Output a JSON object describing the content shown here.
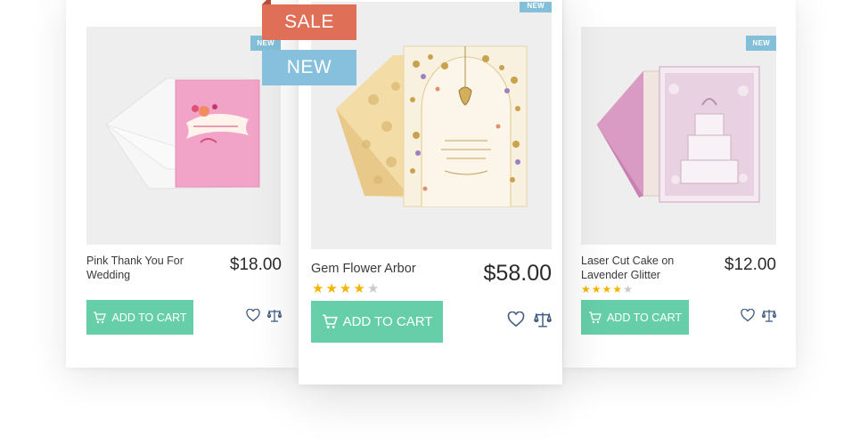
{
  "ribbons": {
    "sale": "SALE",
    "new": "NEW"
  },
  "products": [
    {
      "title": "Pink Thank You For Wedding",
      "price": "$18.00",
      "badge": "NEW",
      "cart_label": "ADD TO CART",
      "rating": null
    },
    {
      "title": "Gem Flower Arbor",
      "price": "$58.00",
      "badge": "NEW",
      "cart_label": "ADD TO CART",
      "rating": 4,
      "rating_max": 5
    },
    {
      "title": "Laser Cut Cake on Lavender Glitter",
      "price": "$12.00",
      "badge": "NEW",
      "cart_label": "ADD TO CART",
      "rating": 4,
      "rating_max": 5
    }
  ],
  "colors": {
    "cart_button": "#66cfa9",
    "sale_ribbon": "#e06f58",
    "new_ribbon": "#86c0dc",
    "new_badge": "#83bfd9",
    "star": "#f4b400",
    "star_off": "#c9c9c9",
    "icon": "#3d5a80"
  },
  "icons": {
    "cart": "shopping-cart-icon",
    "wishlist": "heart-icon",
    "compare": "scales-icon"
  }
}
